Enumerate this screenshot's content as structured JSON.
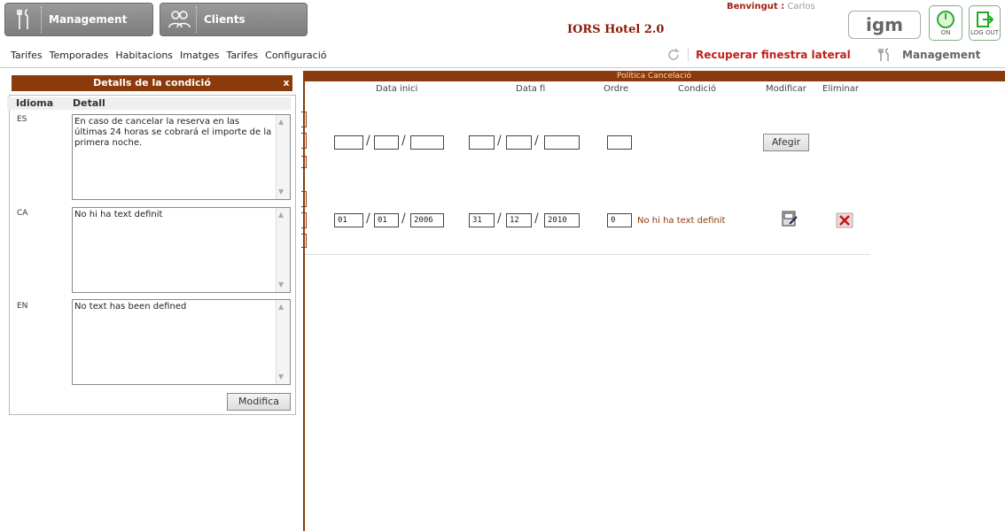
{
  "topbar": {
    "tabs": [
      {
        "label": "Management",
        "icon": "tools-icon"
      },
      {
        "label": "Clients",
        "icon": "users-icon"
      }
    ],
    "app_title": "IORS Hotel 2.0",
    "welcome_label": "Benvingut :",
    "welcome_user": "Carlos",
    "logo_text": "igm",
    "on_label": "ON",
    "logout_label": "LOG OUT"
  },
  "menubar": {
    "items": [
      "Tarifes",
      "Temporades",
      "Habitacions",
      "Imatges",
      "Tarifes",
      "Configuració"
    ],
    "recover_label": "Recuperar finestra lateral",
    "management_label": "Management"
  },
  "main": {
    "header": "Política Cancelació",
    "columns": [
      "Data inici",
      "Data fi",
      "Ordre",
      "Condició",
      "Modificar",
      "Eliminar"
    ],
    "new_row": {
      "button": "Afegir"
    },
    "rows": [
      {
        "start_day": "01",
        "start_month": "01",
        "start_year": "2006",
        "end_day": "31",
        "end_month": "12",
        "end_year": "2010",
        "order": "0",
        "condition": "No hi ha text definit"
      }
    ]
  },
  "panel": {
    "title": "Detalls de la condició",
    "close_label": "x",
    "col_language": "Idioma",
    "col_detail": "Detall",
    "entries": [
      {
        "lang": "ES",
        "text": "En caso de cancelar la reserva en las últimas 24 horas se cobrará el importe de la primera noche."
      },
      {
        "lang": "CA",
        "text": "No hi ha text definit"
      },
      {
        "lang": "EN",
        "text": "No text has been defined"
      }
    ],
    "submit_label": "Modifica"
  },
  "colors": {
    "brand": "#8b3a0c",
    "accent_red": "#c0201a"
  }
}
